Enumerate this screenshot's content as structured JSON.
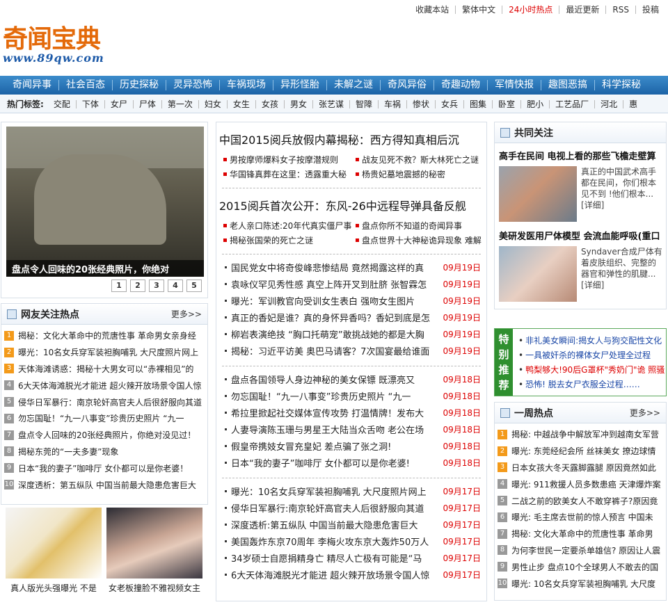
{
  "top_links": [
    "收藏本站",
    "繁体中文",
    "24小时热点",
    "最近更新",
    "RSS",
    "投稿"
  ],
  "logo": {
    "name": "奇闻宝典",
    "url_text": "www.89qw.com"
  },
  "nav": [
    "奇闻异事",
    "社会百态",
    "历史探秘",
    "灵异恐怖",
    "车祸现场",
    "异形怪胎",
    "未解之谜",
    "奇风异俗",
    "奇趣动物",
    "军情快报",
    "趣图恶搞",
    "科学探秘"
  ],
  "tags": {
    "label": "热门标签:",
    "items": [
      "交配",
      "下体",
      "女尸",
      "尸体",
      "第一次",
      "妇女",
      "女生",
      "女孩",
      "男女",
      "张艺谋",
      "智障",
      "车祸",
      "惨状",
      "女兵",
      "图集",
      "卧室",
      "肥小",
      "工艺品厂",
      "河北",
      "惠"
    ]
  },
  "slider": {
    "caption": "盘点令人回味的20张经典照片，你绝对",
    "pages": [
      "1",
      "2",
      "3",
      "4",
      "5"
    ],
    "watermark": "89qw.com"
  },
  "hot1": {
    "title": "网友关注热点",
    "more": "更多>>",
    "items": [
      {
        "n": "1",
        "t": "揭秘：文化大革命中的荒唐性事 革命男女亲身经"
      },
      {
        "n": "2",
        "t": "曝光：10名女兵穿军装袒胸哺乳 大尺度照片网上"
      },
      {
        "n": "3",
        "t": "天体海滩诱惑：揭秘十大男女可以“赤裸相见”的"
      },
      {
        "n": "4",
        "t": "6大天体海滩脱光才能进 超火辣开放场景令国人惊"
      },
      {
        "n": "5",
        "t": "侵华日军暴行：南京轮奸高官夫人后很舒服向其道"
      },
      {
        "n": "6",
        "t": "勿忘国耻！“九一八事变”珍贵历史照片 “九一"
      },
      {
        "n": "7",
        "t": "盘点令人回味的20张经典照片，你绝对没见过！"
      },
      {
        "n": "8",
        "t": "揭秘东莞的“一夫多妻”现象"
      },
      {
        "n": "9",
        "t": "日本“我的妻子”咖啡厅 女仆都可以是你老婆！"
      },
      {
        "n": "10",
        "t": "深度透析：第五纵队 中国当前最大隐患危害巨大"
      }
    ]
  },
  "thumbs": [
    {
      "caption": "真人版光头强曝光 不是"
    },
    {
      "caption": "女老板撞脸不雅视频女主"
    }
  ],
  "mid": {
    "headline1": "中国2015阅兵放假内幕揭秘：西方得知真相后沉",
    "subs1": [
      "男按摩师爆料女子按摩潜规则",
      "战友见死不救？斯大林死亡之谜",
      "华国锋真葬在这里：透露重大秘",
      "杨贵妃墓地震撼的秘密"
    ],
    "headline2": "2015阅兵首次公开：东风-26中远程导弹具备反舰",
    "subs2": [
      "老人亲口陈述:20年代真实僵尸事",
      "盘点你所不知道的奇闻异事",
      "揭秘张国荣的死亡之谜",
      "盘点世界十大神秘诡异现象 难解"
    ],
    "group1": [
      {
        "t": "国民党女中将奇俊峰悲惨结局 竟然揭露这样的真",
        "d": "09月19日"
      },
      {
        "t": "袁咏仪罕见秀性感 真空上阵开叉到肚脐 张智霖怎",
        "d": "09月19日"
      },
      {
        "t": "曝光：军训教官向受训女生表白 强吻女生图片",
        "d": "09月19日"
      },
      {
        "t": "真正的香妃是谁？真的身怀异香吗？香妃到底是怎",
        "d": "09月19日"
      },
      {
        "t": "柳岩表演绝技 “胸口托萌宠”敢挑战她的都是大胸",
        "d": "09月19日"
      },
      {
        "t": "揭秘：习近平访美 奥巴马请客？7次国宴最给谁面",
        "d": "09月19日"
      }
    ],
    "group2": [
      {
        "t": "盘点各国领导人身边神秘的美女保镖 既漂亮又",
        "d": "09月18日"
      },
      {
        "t": "勿忘国耻！“九一八事变”珍贵历史照片 “九一",
        "d": "09月18日"
      },
      {
        "t": "希拉里掀起社交媒体宣传攻势 打温情牌！发布大",
        "d": "09月18日"
      },
      {
        "t": "人妻导演陈玉珊与男星王大陆当众舌吻 老公在场",
        "d": "09月18日"
      },
      {
        "t": "假皇帝携妓女冒充皇妃 差点骗了张之洞!",
        "d": "09月18日"
      },
      {
        "t": "日本“我的妻子”咖啡厅 女仆都可以是你老婆!",
        "d": "09月18日"
      }
    ],
    "group3": [
      {
        "t": "曝光：10名女兵穿军装袒胸哺乳 大尺度照片网上",
        "d": "09月17日"
      },
      {
        "t": "侵华日军暴行:南京轮奸高官夫人后很舒服向其道",
        "d": "09月17日"
      },
      {
        "t": "深度透析:第五纵队 中国当前最大隐患危害巨大",
        "d": "09月17日"
      },
      {
        "t": "美国轰炸东京70周年 李梅火攻东京大轰炸50万人",
        "d": "09月17日"
      },
      {
        "t": "34岁硕士自愿捐精身亡 精尽人亡极有可能是“马",
        "d": "09月17日"
      },
      {
        "t": "6大天体海滩脱光才能进 超火辣开放场景令国人惊",
        "d": "09月17日"
      }
    ]
  },
  "focus": {
    "title": "共同关注",
    "items": [
      {
        "title": "高手在民间 电视上看的那些飞檐走壁算",
        "text": "真正的中国武术高手都在民间，你们根本见不到 !他们根本...",
        "more": "[详细]"
      },
      {
        "title": "美研发医用尸体模型 会流血能呼吸(重口",
        "text": "Syndaver合成尸体有着皮肤组织、完整的器官和弹性的肌腱...",
        "more": "[详细]"
      }
    ]
  },
  "special": {
    "label": [
      "特",
      "别",
      "推",
      "荐"
    ],
    "items": [
      {
        "t": "非礼美女瞬间:揭女人与狗交配性文化",
        "c": "blue"
      },
      {
        "t": "一具被奸杀的裸体女尸处理全过程",
        "c": "blue"
      },
      {
        "t": "鸭梨够大!90后G罩杯\"秀奶门\"诡 照骚",
        "c": "red"
      },
      {
        "t": "恐怖! 脱去女尸衣服全过程……",
        "c": "blue"
      }
    ]
  },
  "week": {
    "title": "一周热点",
    "more": "更多>>",
    "items": [
      {
        "n": "1",
        "t": "揭秘: 中越战争中解放军冲到越南女军营"
      },
      {
        "n": "2",
        "t": "曝光: 东莞经纪会所 丝袜美女 撩边球情"
      },
      {
        "n": "3",
        "t": "日本女孩大冬天露脚露腿 原因竟然如此"
      },
      {
        "n": "4",
        "t": "曝光: 911救援人员多数患癌 天津爆炸案"
      },
      {
        "n": "5",
        "t": "二战之前的欧美女人不敢穿裤子?原因竟"
      },
      {
        "n": "6",
        "t": "曝光: 毛主席去世前的惊人预言 中国未"
      },
      {
        "n": "7",
        "t": "揭秘: 文化大革命中的荒唐性事 革命男"
      },
      {
        "n": "8",
        "t": "为何李世民一定要杀单雄信? 原因让人震"
      },
      {
        "n": "9",
        "t": "男性止步 盘点10个全球男人不敢去的国"
      },
      {
        "n": "10",
        "t": "曝光: 10名女兵穿军装袒胸哺乳 大尺度"
      }
    ]
  }
}
